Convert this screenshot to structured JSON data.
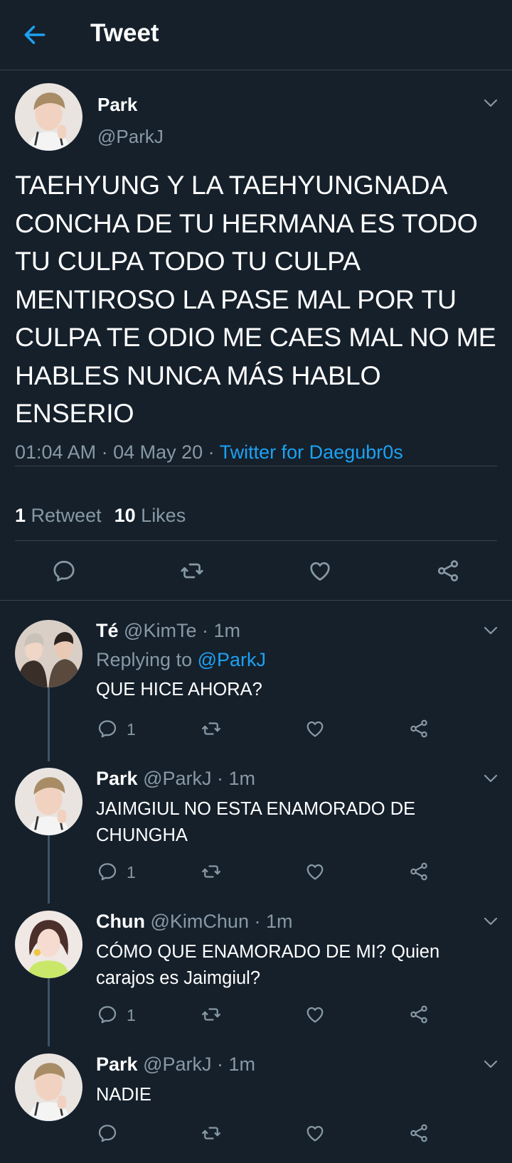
{
  "header": {
    "title": "Tweet",
    "back_icon": "arrow-left-icon"
  },
  "colors": {
    "background": "#15202b",
    "accent": "#1da1f2",
    "muted": "#8899a6",
    "divider": "#38444d"
  },
  "main_tweet": {
    "name": "Park",
    "handle": "@ParkJ",
    "text": "TAEHYUNG Y LA TAEHYUNGNADA CONCHA DE TU HERMANA ES TODO TU CULPA TODO TU CULPA MENTIROSO LA PASE MAL POR TU CULPA TE ODIO ME CAES MAL NO ME HABLES NUNCA MÁS HABLO ENSERIO",
    "time": "01:04 AM · 04 May 20 · ",
    "source": "Twitter for Daegubr0s",
    "retweet_count": "1",
    "retweet_label": "Retweet",
    "like_count": "10",
    "like_label": "Likes"
  },
  "replies": [
    {
      "name": "Té",
      "handle": "@KimTe",
      "time": " · 1m",
      "replying_prefix": "Replying to ",
      "replying_to": "@ParkJ",
      "text": "QUE HICE AHORA?",
      "reply_count": "1"
    },
    {
      "name": "Park",
      "handle": "@ParkJ",
      "time": " · 1m",
      "text": "JAIMGIUL NO ESTA ENAMORADO DE CHUNGHA",
      "reply_count": "1"
    },
    {
      "name": "Chun",
      "handle": "@KimChun",
      "time": " · 1m",
      "text": "CÓMO QUE ENAMORADO DE MI? Quien carajos es Jaimgiul?",
      "reply_count": "1"
    },
    {
      "name": "Park",
      "handle": "@ParkJ",
      "time": " · 1m",
      "text": "NADIE",
      "reply_count": ""
    }
  ]
}
